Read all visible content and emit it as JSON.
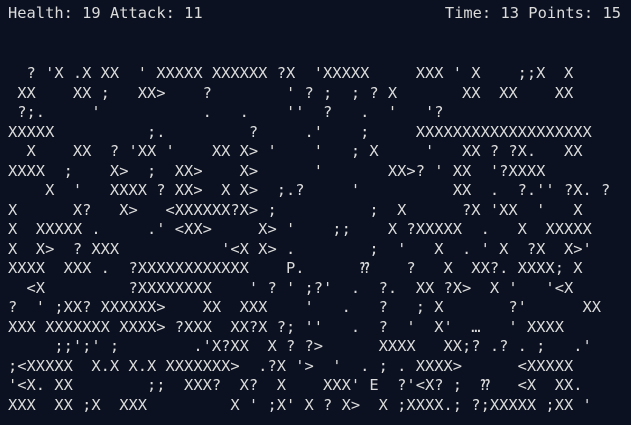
{
  "hud": {
    "health_label": "Health:",
    "health": "19",
    "attack_label": "Attack:",
    "attack": "11",
    "time_label": "Time:",
    "time": "13",
    "points_label": "Points:",
    "points": "15"
  },
  "map_rows": [
    "  ? 'X .X XX  ' XXXXX XXXXXX ?X  'XXXXX     XXX ' X    ;;X  X",
    " XX    XX ;   XX>    ?        ' ? ;  ; ? X       XX  XX    XX",
    " ?;.     '           .   .    ''  ?   .  '   '?",
    "XXXXX          ;.         ?     .'    ;     XXXXXXXXXXXXXXXXXXX",
    "  X    XX  ? 'XX '    XX X> '    '   ; X     '   XX ? ?X.   XX",
    "XXXX  ;    X>  ;  XX>    X>      '       XX>? ' XX  '?XXXX",
    "    X  '   XXXX ? XX>  X X>  ;.?     '          XX  .  ?.'' ?X. ?",
    "X      X?   X>   <XXXXXX?X> ;          ;  X      ?X 'XX  '   X",
    "X  XXXXX .     .' <XX>     X> '    ;;    X ?XXXXX  .   X  XXXXX",
    "X  X>  ? XXX           '<X X> .        ;  '   X  . ' X  ?X  X>'",
    "XXXX  XXX .  ?XXXXXXXXXXXX    P.      ⁇    ?   X  XX?. XXXX; X",
    "  <X         ?XXXXXXXX    ' ? ' ;?'  .  ?.  XX ?X>  X '   '<X",
    "?  ' ;XX? XXXXXX>    XX  XXX    '   .   ?   ; X       ?'      XX",
    "XXX XXXXXXX XXXX> ?XXX  XX?X ?; ''   .  ?  '  X'  …   ' XXXX",
    "     ;;';' ;        .'X?XX  X ? ?>      XXXX   XX;? .? . ;   .'",
    ";<XXXXX  X.X X.X XXXXXXX>  .?X '>  '  . ; . XXXX>      <XXXXX",
    "'<X. XX        ;;  XXX?  X?  X    XXX' E  ?'<X? ;  ⁇   <X  XX.",
    "XXX  XX ;X  XXX         X ' ;X' X ? X>  X ;XXXX.; ?;XXXXX ;XX '"
  ]
}
